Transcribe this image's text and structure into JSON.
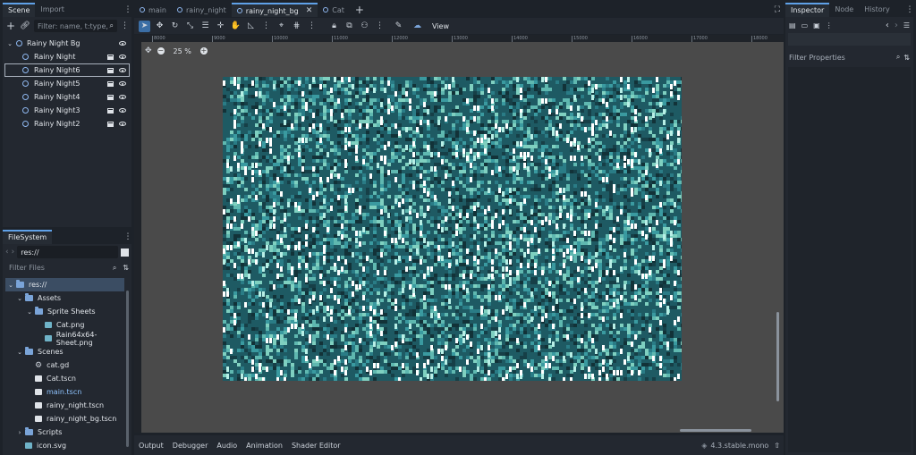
{
  "scene_dock": {
    "tabs": [
      "Scene",
      "Import"
    ],
    "filter_placeholder": "Filter: name, t:type, ",
    "root": "Rainy Night Bg",
    "children": [
      "Rainy Night",
      "Rainy Night6",
      "Rainy Night5",
      "Rainy Night4",
      "Rainy Night3",
      "Rainy Night2"
    ],
    "selected_child": "Rainy Night6"
  },
  "filesystem": {
    "tab": "FileSystem",
    "path": "res://",
    "filter_placeholder": "Filter Files",
    "items": [
      {
        "label": "res://",
        "type": "folder",
        "indent": 0,
        "selected": true
      },
      {
        "label": "Assets",
        "type": "folder",
        "indent": 1
      },
      {
        "label": "Sprite Sheets",
        "type": "folder",
        "indent": 2
      },
      {
        "label": "Cat.png",
        "type": "image",
        "indent": 3
      },
      {
        "label": "Rain64x64-Sheet.png",
        "type": "image",
        "indent": 3
      },
      {
        "label": "Scenes",
        "type": "folder",
        "indent": 1
      },
      {
        "label": "cat.gd",
        "type": "script",
        "indent": 2
      },
      {
        "label": "Cat.tscn",
        "type": "scene",
        "indent": 2
      },
      {
        "label": "main.tscn",
        "type": "scene",
        "indent": 2,
        "highlight": true
      },
      {
        "label": "rainy_night.tscn",
        "type": "scene",
        "indent": 2
      },
      {
        "label": "rainy_night_bg.tscn",
        "type": "scene",
        "indent": 2
      },
      {
        "label": "Scripts",
        "type": "folder",
        "indent": 1
      },
      {
        "label": "icon.svg",
        "type": "image",
        "indent": 1
      }
    ]
  },
  "scene_tabs": [
    {
      "label": "main",
      "active": false
    },
    {
      "label": "rainy_night",
      "active": false
    },
    {
      "label": "rainy_night_bg",
      "active": true
    },
    {
      "label": "Cat",
      "active": false
    }
  ],
  "toolbar": {
    "view_label": "View"
  },
  "viewport": {
    "zoom": "25 %",
    "ruler_ticks": [
      "8000",
      "9000",
      "10000",
      "11000",
      "12000",
      "13000",
      "14000",
      "15000",
      "16000",
      "17000",
      "18000"
    ]
  },
  "bottom_tabs": [
    "Output",
    "Debugger",
    "Audio",
    "Animation",
    "Shader Editor"
  ],
  "version": "4.3.stable.mono",
  "inspector": {
    "tabs": [
      "Inspector",
      "Node",
      "History"
    ],
    "filter_placeholder": "Filter Properties"
  },
  "colors": {
    "accent": "#5fa1e8",
    "rain_bg": "#1e5a63"
  }
}
